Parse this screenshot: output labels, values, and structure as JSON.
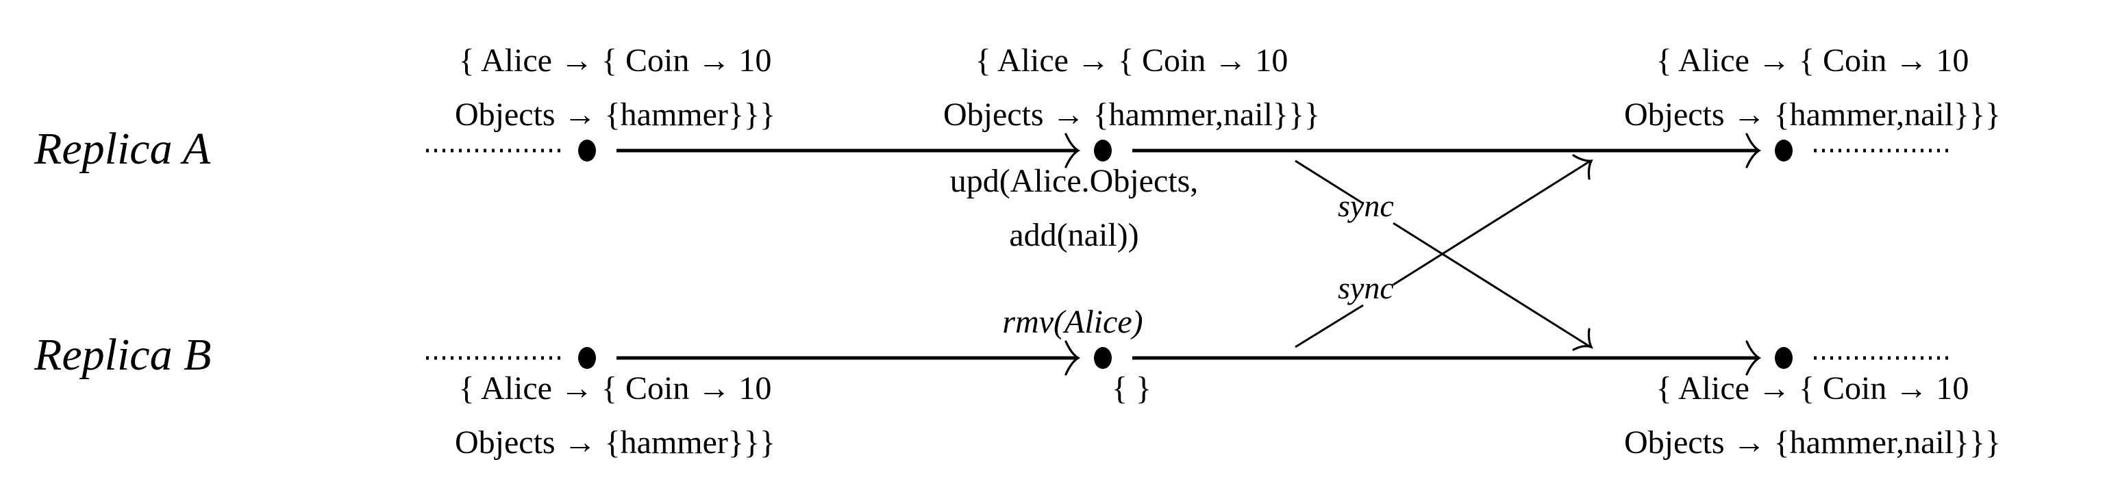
{
  "diagram": {
    "replicas": [
      {
        "label": "Replica A",
        "events": [
          {
            "state_lines": [
              "{ Alice → { Coin → 10",
              "Objects → {hammer}}}"
            ]
          },
          {
            "state_lines": [
              "{ Alice → { Coin → 10",
              "Objects → {hammer,nail}}}"
            ],
            "operation_lines": [
              "upd(Alice.Objects,",
              "add(nail))"
            ]
          },
          {
            "state_lines": [
              "{ Alice → { Coin → 10",
              "Objects → {hammer,nail}}}"
            ]
          }
        ]
      },
      {
        "label": "Replica B",
        "events": [
          {
            "state_lines": [
              "{ Alice → { Coin → 10",
              "Objects → {hammer}}}"
            ]
          },
          {
            "state_lines": [
              "{ }"
            ],
            "operation_lines": [
              "rmv(Alice)"
            ]
          },
          {
            "state_lines": [
              "{ Alice → { Coin → 10",
              "Objects → {hammer,nail}}}"
            ]
          }
        ]
      }
    ],
    "sync_messages": [
      {
        "label": "sync",
        "from": "Replica A",
        "to": "Replica B"
      },
      {
        "label": "sync",
        "from": "Replica B",
        "to": "Replica A"
      }
    ]
  }
}
